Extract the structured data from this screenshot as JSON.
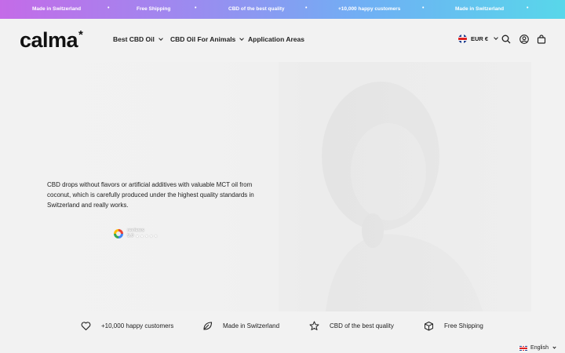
{
  "ticker": {
    "items": [
      "Made in Switzerland",
      "Free Shipping",
      "CBD of the best quality",
      "+10,000 happy customers",
      "Made in Switzerland"
    ],
    "separator": "•"
  },
  "header": {
    "logo": "calma",
    "logo_mark": "*",
    "nav": [
      {
        "label": "Best CBD Oil",
        "has_dropdown": true
      },
      {
        "label": "CBD Oil For Animals",
        "has_dropdown": true
      },
      {
        "label": "Application Areas",
        "has_dropdown": false
      }
    ],
    "currency": "EUR €",
    "icons": [
      "search-icon",
      "account-icon",
      "cart-icon"
    ]
  },
  "hero": {
    "description": "CBD drops without flavors or artificial additives with valuable MCT oil from coconut, which is carefully produced under the highest quality standards in Switzerland and really works.",
    "review_label": "reviews",
    "review_score": "5.0",
    "review_stars": "★★★★★"
  },
  "features": [
    {
      "icon": "heart-icon",
      "label": "+10,000 happy customers"
    },
    {
      "icon": "leaf-icon",
      "label": "Made in Switzerland"
    },
    {
      "icon": "star-icon",
      "label": "CBD of the best quality"
    },
    {
      "icon": "box-icon",
      "label": "Free Shipping"
    }
  ],
  "language": {
    "selected": "English"
  },
  "colors": {
    "ticker_start": "#c46be8",
    "ticker_end": "#58d7ea",
    "background": "#f2f2f2"
  }
}
